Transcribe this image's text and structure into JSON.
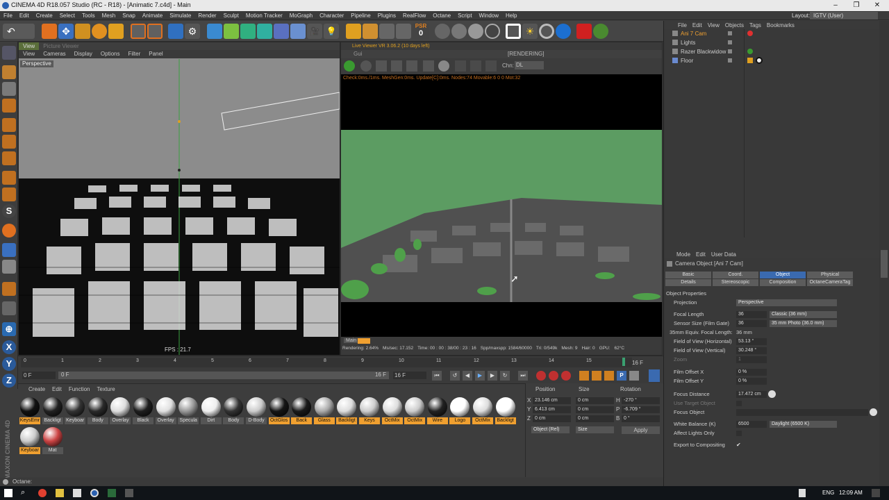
{
  "window": {
    "title": "CINEMA 4D R18.057 Studio (RC - R18) - [Animatic 7.c4d] - Main",
    "minimize": "–",
    "maximize": "❐",
    "close": "✕"
  },
  "menubar": [
    "File",
    "Edit",
    "Create",
    "Select",
    "Tools",
    "Mesh",
    "Snap",
    "Animate",
    "Simulate",
    "Render",
    "Sculpt",
    "Motion Tracker",
    "MoGraph",
    "Character",
    "Pipeline",
    "Plugins",
    "RealFlow",
    "Octane",
    "Script",
    "Window",
    "Help"
  ],
  "layout": {
    "label": "Layout:",
    "value": "IGTV (User)"
  },
  "toolbar": {
    "psr_label": "PSR",
    "psr_value": "0"
  },
  "viewport": {
    "tabs": [
      "View",
      "Picture Viewer"
    ],
    "menu": [
      "View",
      "Cameras",
      "Display",
      "Options",
      "Filter",
      "Panel"
    ],
    "label": "Perspective",
    "fps": "FPS : 21.7"
  },
  "liveviewer": {
    "title": "Live Viewer VR 3.06.2 (10 days left)",
    "menu": "Gui",
    "status": "[RENDERING]",
    "chn_label": "Chn:",
    "chn_value": "DL",
    "info": "Check:0ms./1ms. MeshGen:0ms. Update[C]:0ms. Nodes:74 Movable:6  0 0 Mot:32",
    "tab": "Main",
    "bottom": [
      "Rendering: 2.64%",
      "Ms/sec: 17.152",
      "Time: 00 : 00 : 38/00 : 23 : 16",
      "Spp/maxspp: 1584/60000",
      "Tri: 0/549k",
      "Mesh: 9",
      "Hair: 0",
      "GPU:",
      "62°C"
    ]
  },
  "manager": {
    "menu": [
      "File",
      "Edit",
      "View",
      "Objects",
      "Tags",
      "Bookmarks"
    ],
    "objects": [
      {
        "label": "Ani 7 Cam",
        "selected": true
      },
      {
        "label": "Lights",
        "selected": false
      },
      {
        "label": "Razer Blackwidow",
        "selected": false
      },
      {
        "label": "Floor",
        "selected": false
      }
    ]
  },
  "attributes": {
    "menu": [
      "Mode",
      "Edit",
      "User Data"
    ],
    "header": "Camera Object [Ani 7 Cam]",
    "tabs_row1": [
      "Basic",
      "Coord.",
      "Object",
      "Physical"
    ],
    "tabs_row2": [
      "Details",
      "Stereoscopic",
      "Composition",
      "OctaneCameraTag"
    ],
    "section": "Object Properties",
    "projection": {
      "label": "Projection",
      "value": "Perspective"
    },
    "focal_length": {
      "label": "Focal Length",
      "value": "36",
      "preset": "Classic (36 mm)"
    },
    "sensor_size": {
      "label": "Sensor Size (Film Gate)",
      "value": "36",
      "preset": "35 mm Photo (36.0 mm)"
    },
    "equiv_focal": {
      "label": "35mm Equiv. Focal Length:",
      "value": "36 mm"
    },
    "fov_h": {
      "label": "Field of View (Horizontal)",
      "value": "53.13 °"
    },
    "fov_v": {
      "label": "Field of View (Vertical)",
      "value": "30.248 °"
    },
    "zoom": {
      "label": "Zoom",
      "value": "1"
    },
    "film_offset_x": {
      "label": "Film Offset X",
      "value": "0 %"
    },
    "film_offset_y": {
      "label": "Film Offset Y",
      "value": "0 %"
    },
    "focus_distance": {
      "label": "Focus Distance",
      "value": "17.472 cm"
    },
    "use_target": {
      "label": "Use Target Object"
    },
    "focus_object": {
      "label": "Focus Object"
    },
    "white_balance": {
      "label": "White Balance (K)",
      "value": "6500",
      "preset": "Daylight (6500 K)"
    },
    "affect_lights": {
      "label": "Affect Lights Only"
    },
    "export_comp": {
      "label": "Export to Compositing",
      "check": "✔"
    }
  },
  "timeline": {
    "ticks": [
      "0",
      "1",
      "2",
      "3",
      "4",
      "5",
      "6",
      "7",
      "8",
      "9",
      "10",
      "11",
      "12",
      "13",
      "14",
      "15"
    ],
    "current": "16 F",
    "start": "0 F",
    "start2": "0 F",
    "end": "16 F",
    "end2": "16 F"
  },
  "materials": {
    "menu": [
      "Create",
      "Edit",
      "Function",
      "Texture"
    ],
    "items": [
      {
        "label": "KeysEmr",
        "color": "#111",
        "hl": true
      },
      {
        "label": "Backligt",
        "color": "#222",
        "hl": false
      },
      {
        "label": "Keyboar",
        "color": "#333",
        "hl": false
      },
      {
        "label": "Body",
        "color": "#2a2a2a",
        "hl": false
      },
      {
        "label": "Overlay",
        "color": "#ddd",
        "hl": false
      },
      {
        "label": "Black",
        "color": "#1e1e1e",
        "hl": false
      },
      {
        "label": "Overlay",
        "color": "#e0e0e0",
        "hl": false
      },
      {
        "label": "Specula",
        "color": "#999",
        "hl": false
      },
      {
        "label": "Dirt",
        "color": "#eee",
        "hl": false
      },
      {
        "label": "Body",
        "color": "#333",
        "hl": false
      },
      {
        "label": "D-Body",
        "color": "#ccc",
        "hl": false
      },
      {
        "label": "OctGlos",
        "color": "#151515",
        "hl": true
      },
      {
        "label": "Back",
        "color": "#1a1a1a",
        "hl": true
      },
      {
        "label": "Glass",
        "color": "#aaa",
        "hl": true
      },
      {
        "label": "Backligt",
        "color": "#ddd",
        "hl": true
      },
      {
        "label": "Keys",
        "color": "#ccc",
        "hl": true
      },
      {
        "label": "OctMix",
        "color": "#ddd",
        "hl": true
      },
      {
        "label": "OctMix",
        "color": "#ccc",
        "hl": true
      },
      {
        "label": "Wire",
        "color": "#222",
        "hl": true
      },
      {
        "label": "Logo",
        "color": "#fff",
        "hl": true
      },
      {
        "label": "OctMix",
        "color": "#ddd",
        "hl": true
      },
      {
        "label": "Backligt",
        "color": "#fff",
        "hl": true
      },
      {
        "label": "Keyboar",
        "color": "#ccc",
        "hl": true
      },
      {
        "label": "Mat",
        "color": "#c44",
        "hl": false
      }
    ]
  },
  "coords": {
    "headers": [
      "Position",
      "Size",
      "Rotation"
    ],
    "rows": [
      {
        "axis": "X",
        "pos": "23.146 cm",
        "size": "0 cm",
        "raxis": "H",
        "rot": "-270 °"
      },
      {
        "axis": "Y",
        "pos": "6.413 cm",
        "size": "0 cm",
        "raxis": "P",
        "rot": "-6.709 °"
      },
      {
        "axis": "Z",
        "pos": "0 cm",
        "size": "0 cm",
        "raxis": "B",
        "rot": "0 °"
      }
    ],
    "mode": "Object (Rel)",
    "size_mode": "Size",
    "apply": "Apply"
  },
  "statusbar": "Octane:",
  "taskbar": {
    "lang": "ENG",
    "time": "12:09 AM"
  },
  "brand": "MAXON CINEMA 4D"
}
